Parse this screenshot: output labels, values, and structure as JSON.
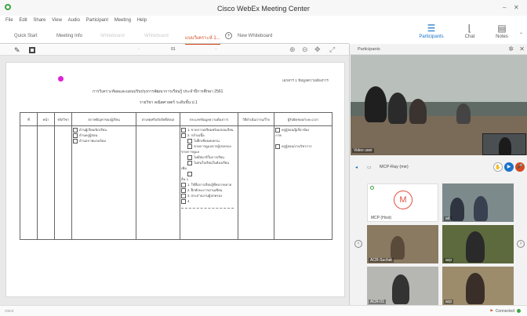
{
  "window": {
    "title": "Cisco WebEx Meeting Center",
    "minimize": "–",
    "close": "✕"
  },
  "menu": [
    "File",
    "Edit",
    "Share",
    "View",
    "Audio",
    "Participant",
    "Meeting",
    "Help"
  ],
  "rightbar": {
    "participants_label": "Participants",
    "chat_label": "Chat",
    "notes_label": "Notes"
  },
  "tabs": [
    {
      "label": "Quick Start",
      "state": "normal"
    },
    {
      "label": "Meeting Info",
      "state": "normal"
    },
    {
      "label": "Whiteboard",
      "state": "faded"
    },
    {
      "label": "Whiteboard",
      "state": "faded"
    },
    {
      "label": "แบบวิเคราะห์ 1...",
      "state": "active"
    },
    {
      "label": "New Whiteboard",
      "state": "normal"
    }
  ],
  "pager": {
    "page": "01"
  },
  "document": {
    "ref": "เอกสาร 1 ข้อมูลความต้องการ",
    "title": "การวิเคราะห์ผลและแผนปรับปรุงการพัฒนาการเรียนรู้ ประจำปีการศึกษา 2561",
    "subtitle": "รายวิชา คณิตศาสตร์ ระดับชั้น ป.1",
    "headers": [
      "ที่",
      "หน้า",
      "รหัสวิชา",
      "สภาพปัญหาของผู้เรียน",
      "สาเหตุหรือปัจจัยที่ส่งผล",
      "ประเภทข้อมูลความต้องการ",
      "วิธีดำเนินการแก้ไข",
      "ผู้รับผิดชอบ/ระยะเวลา"
    ],
    "col4_items": [
      "ด้านผู้เรียน/นักเรียน",
      "ด้านครูผู้สอน",
      "ด้านสภาพแวดล้อม"
    ],
    "col6_items": [
      {
        "text": "1. ขาดการเตรียมพร้อมก่อนเรียน",
        "indent": false
      },
      {
        "text": "2. กล้ามเนื้อ",
        "indent": false
      },
      {
        "text": "ไม่ฝึกเขียนทบทวน",
        "indent": true
      },
      {
        "text": "ขาดการดูแลจากผู้ปกครอง",
        "indent": true
      },
      {
        "text": "ขาดการดูแล",
        "indent": false,
        "plain": true
      },
      {
        "text": "ไม่มีสมาธิในการเรียน",
        "indent": true
      },
      {
        "text": "ไม่สนใจเรียนในห้องเรียน",
        "indent": true
      },
      {
        "text": "เพิ่ม",
        "indent": false,
        "plain": true
      },
      {
        "text": "",
        "indent": true
      },
      {
        "text": "อื่น ๆ",
        "indent": false,
        "plain": true
      },
      {
        "text": "1. ใช้สื่อการเรียนรู้ที่หลากหลาย",
        "indent": false
      },
      {
        "text": "2. ฝึกทักษะการอ่านเขียน",
        "indent": false
      },
      {
        "text": "3. ประสานงานผู้ปกครอง",
        "indent": false
      },
      {
        "text": "4.",
        "indent": false
      }
    ],
    "col8_items": [
      "ครูผู้สอน/ผู้เกี่ยวข้อง",
      "ครูผู้สอน/งานวิชาการ"
    ],
    "col8_line": "ภาค"
  },
  "panel": {
    "title": "Participants",
    "main_video_label": "Video user",
    "active_speaker": "MCP-Ray (me)",
    "thumbs": [
      {
        "caption": "MCP (Host)",
        "type": "host",
        "avatar_letter": "M"
      },
      {
        "caption": "ad",
        "type": "video"
      },
      {
        "caption": "ACR-Suchat",
        "type": "video"
      },
      {
        "caption": "acp",
        "type": "video"
      },
      {
        "caption": "ACR-01",
        "type": "video"
      },
      {
        "caption": "acp",
        "type": "video"
      }
    ]
  },
  "status": {
    "brand": "cisco",
    "connection": "Connected"
  },
  "colors": {
    "accent_blue": "#1a73c8",
    "active_tab": "#d14b1f",
    "connected": "#3aa640",
    "pink_marker": "#e021d6"
  }
}
